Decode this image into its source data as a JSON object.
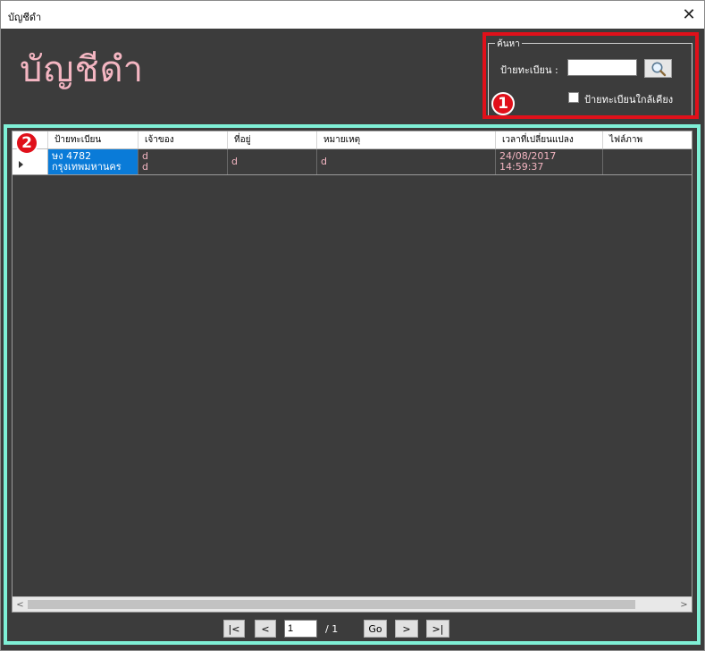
{
  "window": {
    "title": "บัญชีดำ",
    "close_glyph": "✕"
  },
  "header": {
    "big_title": "บัญชีดำ"
  },
  "search": {
    "legend": "ค้นหา",
    "plate_label": "ป้ายทะเบียน :",
    "plate_value": "",
    "nearby_label": "ป้ายทะเบียนใกล้เคียง",
    "nearby_checked": false
  },
  "badges": {
    "one": "1",
    "two": "2"
  },
  "grid": {
    "columns": [
      "ป้ายทะเบียน",
      "เจ้าของ",
      "ที่อยู่",
      "หมายเหตุ",
      "เวลาที่เปลี่ยนแปลง",
      "ไฟล์ภาพ"
    ],
    "rows": [
      {
        "plate_line1": "ษง 4782",
        "plate_line2": "กรุงเทพมหานคร",
        "owner_line1": "d",
        "owner_line2": "d",
        "address": "d",
        "note": "d",
        "changed_line1": "24/08/2017",
        "changed_line2": "14:59:37",
        "image": ""
      }
    ]
  },
  "pager": {
    "first": "|<",
    "prev": "<",
    "page": "1",
    "total": "/ 1",
    "go": "Go",
    "next": ">",
    "last": ">|"
  },
  "scroll": {
    "left_arrow": "<",
    "right_arrow": ">"
  },
  "colors": {
    "accent_red": "#e0101a",
    "accent_teal": "#7ff0d6",
    "text_pink": "#f4b6c2",
    "selection": "#0a7bd8"
  }
}
